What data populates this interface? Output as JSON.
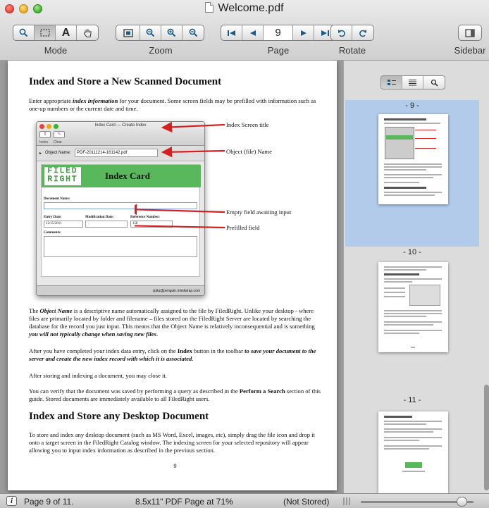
{
  "window": {
    "title": "Welcome.pdf"
  },
  "toolbar": {
    "groups": {
      "mode": "Mode",
      "zoom": "Zoom",
      "page": "Page",
      "rotate": "Rotate",
      "sidebar": "Sidebar"
    },
    "page_number": "9",
    "icons": {
      "mode": [
        "magnifier-icon",
        "marquee-select-icon",
        "text-select-icon",
        "hand-scroll-icon"
      ],
      "zoom": [
        "zoom-to-fit-icon",
        "zoom-actual-icon",
        "zoom-in-icon",
        "zoom-out-icon"
      ],
      "page": [
        "first-page-icon",
        "previous-page-icon",
        "next-page-icon",
        "last-page-icon"
      ],
      "rotate": [
        "rotate-left-icon",
        "rotate-right-icon"
      ],
      "sidebar": "sidebar-toggle-icon"
    }
  },
  "document": {
    "heading1": "Index and Store a New Scanned Document",
    "intro": {
      "before": "Enter appropriate ",
      "emph": "index information",
      "after": " for your document. Some screen fields may be prefilled with information such as one-up numbers or the current date and time."
    },
    "screenshot": {
      "window_title": "Index Card — Create Index",
      "btn_index": "Index",
      "btn_clear": "Clear",
      "object_label": "Object Name:",
      "object_value": "PDF-20111214-161142.pdf",
      "logo_top": "FILED",
      "logo_bottom": "RIGHT",
      "card_title": "Index Card",
      "document_name_label": "Document Name:",
      "entry_date_label": "Entry Date:",
      "entry_date_value": "12/15/2011",
      "modification_date_label": "Modification Date:",
      "reference_number_label": "Reference Number:",
      "reference_number_value": "158",
      "comments_label": "Comments:",
      "status_text": "cpitu@penguin.mindwrap.com"
    },
    "callouts": {
      "title": "Index Screen title",
      "object": "Object (file) Name",
      "empty": "Empty field awaiting input",
      "prefilled": "Prefilled field"
    },
    "para_object": {
      "p1": "The ",
      "emph1": "Object Name",
      "p2": " is a descriptive name automatically assigned to the file by FiledRight. Unlike your desktop - where files are primarily located by folder and filename – files stored on the FiledRight Server are located by searching the database for the record you just input. This means that the Object Name is relatively inconsequential and is something ",
      "emph2": "you will not typically change when saving new files",
      "p3": "."
    },
    "para_after": {
      "p1": "After you have completed your index data entry, click on the ",
      "bold1": "Index",
      "p2": " button in the toolbar ",
      "emph1": "to save your document to the server and create the new index record with which it is associated",
      "p3": "."
    },
    "para_close": "After storing and indexing a document, you may close it.",
    "para_verify": {
      "p1": "You can verify that the document was saved by performing a query as described in the ",
      "bold1": "Perform a Search",
      "p2": " section of this guide. Stored documents are immediately available to all FiledRight users."
    },
    "heading2": "Index and Store any Desktop Document",
    "para_desktop": "To store and index any desktop document (such as MS Word, Excel, images, etc), simply drag the file icon and drop it onto a target screen in the FiledRight Catalog window. The indexing screen for your selected repository will appear allowing you to input index information as described in the previous section.",
    "page_footer": "9"
  },
  "sidebar": {
    "view_icons": [
      "thumbnail-view-icon",
      "table-of-contents-icon",
      "search-icon"
    ],
    "thumbnails": [
      {
        "label": "- 9 -",
        "selected": true
      },
      {
        "label": "- 10 -",
        "selected": false
      },
      {
        "label": "- 11 -",
        "selected": false
      }
    ]
  },
  "statusbar": {
    "page_info": "Page 9 of 11.",
    "page_size": "8.5x11\" PDF Page at 71%",
    "storage": "(Not Stored)"
  }
}
